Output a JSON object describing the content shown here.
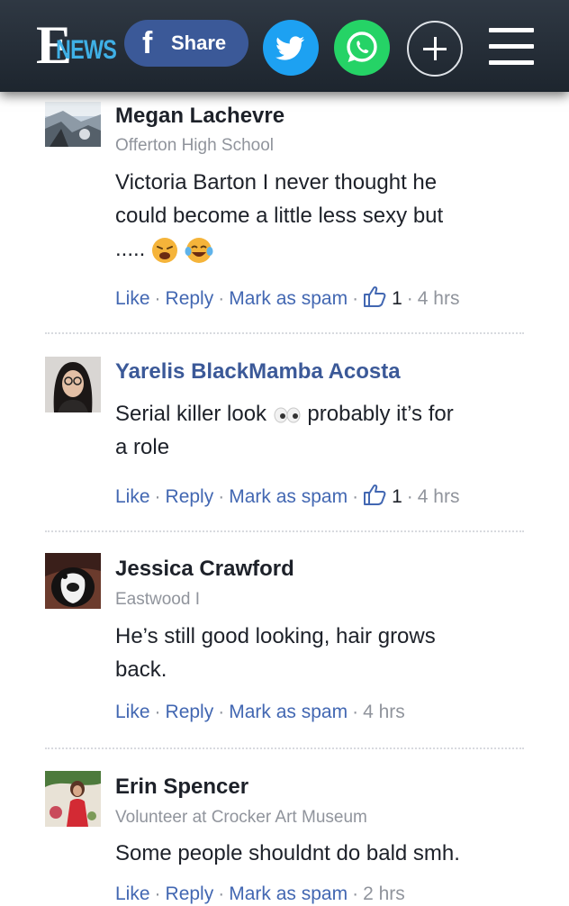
{
  "header": {
    "logo_e": "E",
    "logo_text": "NEWS",
    "share_label": "Share",
    "facebook_glyph": "f",
    "twitter_icon": "twitter-icon",
    "whatsapp_icon": "whatsapp-icon",
    "more_icon": "plus-icon",
    "menu_icon": "hamburger-menu-icon",
    "colors": {
      "facebook": "#3b5998",
      "twitter": "#1da1f2",
      "whatsapp": "#25d366",
      "bar": "#232b34",
      "news_blue": "#3fb0e6"
    }
  },
  "comments": [
    {
      "name": "Megan Lachevre",
      "subtitle": "Offerton High School",
      "text_line1": "Victoria Barton I never thought he",
      "text_line2": "could become a little less sexy but",
      "text_line3": "..... ",
      "emojis": [
        "tired-face-emoji",
        "tears-of-joy-emoji"
      ],
      "like": "Like",
      "reply": "Reply",
      "spam": "Mark as spam",
      "likes": "1",
      "time": "4 hrs"
    },
    {
      "name": "Yarelis BlackMamba Acosta",
      "text_a": "Serial killer look ",
      "text_b": " probably it’s for",
      "text_line2": "a role",
      "emojis": [
        "eyes-emoji"
      ],
      "like": "Like",
      "reply": "Reply",
      "spam": "Mark as spam",
      "likes": "1",
      "time": "4 hrs"
    },
    {
      "name": "Jessica Crawford",
      "subtitle": "Eastwood I",
      "text_line1": "He’s still good looking, hair grows",
      "text_line2": "back.",
      "like": "Like",
      "reply": "Reply",
      "spam": "Mark as spam",
      "time": "4 hrs"
    },
    {
      "name": "Erin Spencer",
      "subtitle": "Volunteer at Crocker Art Museum",
      "text_line1": "Some people shouldnt do bald smh.",
      "like": "Like",
      "reply": "Reply",
      "spam": "Mark as spam",
      "time": "2 hrs"
    }
  ],
  "separator": "·"
}
